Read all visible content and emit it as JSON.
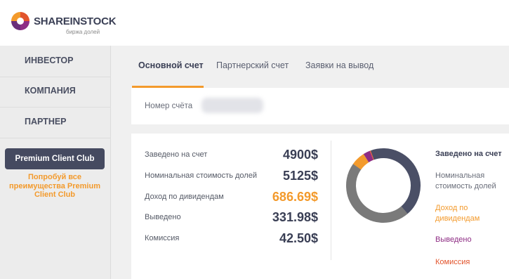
{
  "header": {
    "logo_text": "SHAREINSTOCK",
    "logo_sub": "биржа долей"
  },
  "sidebar": {
    "items": [
      {
        "label": "ИНВЕСТОР"
      },
      {
        "label": "КОМПАНИЯ"
      },
      {
        "label": "ПАРТНЕР"
      }
    ],
    "premium_button": "Premium Client Club",
    "premium_note": "Попробуй все преимущества Premium Client Club"
  },
  "tabs": [
    {
      "label": "Основной счет",
      "active": true
    },
    {
      "label": "Партнерский счет",
      "active": false
    },
    {
      "label": "Заявки на вывод",
      "active": false
    }
  ],
  "account": {
    "label": "Номер счёта"
  },
  "stats": [
    {
      "label": "Заведено на счет",
      "value": "4900$",
      "color": "#3a3f55"
    },
    {
      "label": "Номинальная стоимость долей",
      "value": "5125$",
      "color": "#3a3f55"
    },
    {
      "label": "Доход по дивидендам",
      "value": "686.69$",
      "color": "#f39a2c"
    },
    {
      "label": "Выведено",
      "value": "331.98$",
      "color": "#3a3f55"
    },
    {
      "label": "Комиссия",
      "value": "42.50$",
      "color": "#3a3f55"
    }
  ],
  "chart_data": {
    "type": "pie",
    "series": [
      {
        "name": "Заведено на счет",
        "value": 4900,
        "color": "#4a4f66"
      },
      {
        "name": "Номинальная стоимость долей",
        "value": 5125,
        "color": "#7a7a7a"
      },
      {
        "name": "Доход по дивидендам",
        "value": 686.69,
        "color": "#f39a2c"
      },
      {
        "name": "Выведено",
        "value": 331.98,
        "color": "#8e2d84"
      },
      {
        "name": "Комиссия",
        "value": 42.5,
        "color": "#e2542c"
      }
    ]
  },
  "legend": [
    {
      "label": "Заведено на счет",
      "color": "#3a3f55"
    },
    {
      "label": "Номинальная стоимость долей",
      "color": "#6a6e7a"
    },
    {
      "label": "Доход по дивидендам",
      "color": "#f39a2c"
    },
    {
      "label": "Выведено",
      "color": "#8e2d84"
    },
    {
      "label": "Комиссия",
      "color": "#e2542c"
    }
  ]
}
